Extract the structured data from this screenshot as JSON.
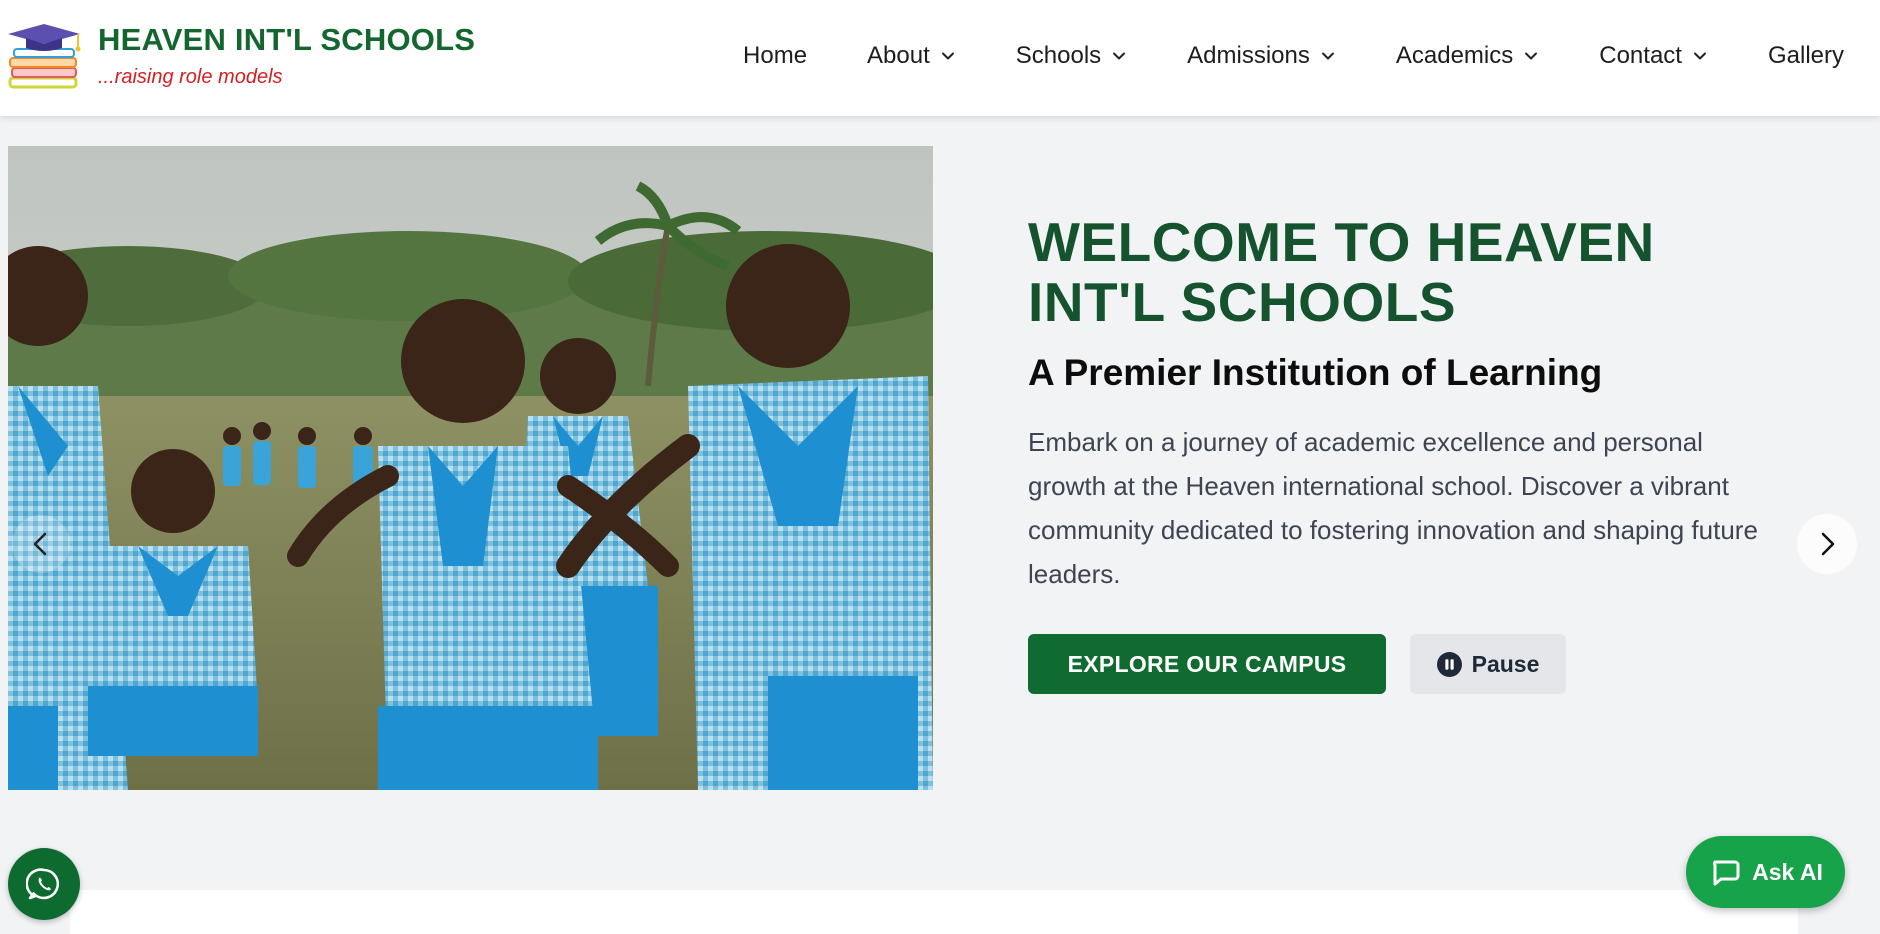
{
  "brand": {
    "name": "HEAVEN INT'L SCHOOLS",
    "tagline": "...raising role models"
  },
  "nav": {
    "items": [
      {
        "label": "Home",
        "has_dropdown": false
      },
      {
        "label": "About",
        "has_dropdown": true
      },
      {
        "label": "Schools",
        "has_dropdown": true
      },
      {
        "label": "Admissions",
        "has_dropdown": true
      },
      {
        "label": "Academics",
        "has_dropdown": true
      },
      {
        "label": "Contact",
        "has_dropdown": true
      },
      {
        "label": "Gallery",
        "has_dropdown": false
      }
    ]
  },
  "hero": {
    "title": "WELCOME TO HEAVEN INT'L SCHOOLS",
    "subtitle": "A Premier Institution of Learning",
    "description": "Embark on a journey of academic excellence and personal growth at the Heaven international school. Discover a vibrant community dedicated to fostering innovation and shaping future leaders.",
    "explore_label": "EXPLORE OUR CAMPUS",
    "pause_label": "Pause",
    "icons": {
      "prev": "chevron-left-icon",
      "next": "chevron-right-icon",
      "pause": "pause-circle-icon"
    }
  },
  "widgets": {
    "ask_ai_label": "Ask AI",
    "whatsapp_icon": "whatsapp-icon",
    "chat_icon": "chat-bubble-icon"
  },
  "colors": {
    "brand_green": "#14662f",
    "title_green": "#14532d",
    "button_green": "#0f6b2f",
    "ask_ai_green": "#16a34a",
    "tagline_red": "#d42020"
  }
}
